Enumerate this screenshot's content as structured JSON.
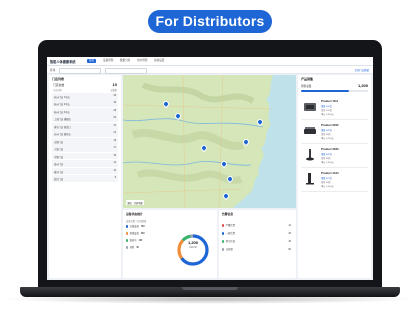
{
  "banner": {
    "label": "For Distributors"
  },
  "app": {
    "brand": "智能人体健康系统",
    "nav": [
      "总览",
      "设备管理",
      "数据分析",
      "用户管理",
      "系统设置"
    ],
    "filter_label": "区域",
    "filter_link": "全部门店数据",
    "left_panel": {
      "title": "门店列表",
      "total_label": "门店总数",
      "total_value": "10",
      "col_name": "门店名称",
      "col_count": "设备数",
      "rows": [
        {
          "name": "杭州门店 1号店",
          "count": "45"
        },
        {
          "name": "杭州门店 2号店",
          "count": "36"
        },
        {
          "name": "杭州门店 3号店",
          "count": "28"
        },
        {
          "name": "上海门店 旗舰店",
          "count": "52"
        },
        {
          "name": "南京门店 新街口",
          "count": "31"
        },
        {
          "name": "苏州门店 园区店",
          "count": "24"
        },
        {
          "name": "无锡门店",
          "count": "19"
        },
        {
          "name": "宁波门店",
          "count": "17"
        },
        {
          "name": "合肥门店",
          "count": "15"
        },
        {
          "name": "温州门店",
          "count": "12"
        },
        {
          "name": "嘉兴门店",
          "count": "10"
        },
        {
          "name": "绍兴门店",
          "count": "8"
        }
      ]
    },
    "map": {
      "tools": "图层 · 全屏地图"
    },
    "bottom_left": {
      "title": "设备状态统计",
      "subtitle": "设备总数 / 在线数量",
      "legend": [
        {
          "label": "在线设备",
          "value": "780",
          "color": "#1e66d6"
        },
        {
          "label": "离线设备",
          "value": "260",
          "color": "#f08c3a"
        },
        {
          "label": "维修中",
          "value": "120",
          "color": "#39b36b"
        },
        {
          "label": "其他",
          "value": "40",
          "color": "#9aa3ae"
        }
      ],
      "donut_value": "1,200",
      "donut_sub": "设备总数",
      "donut_fractions": [
        0.65,
        0.22,
        0.1,
        0.03
      ]
    },
    "bottom_right": {
      "title": "告警信息",
      "items": [
        {
          "label": "严重告警",
          "value": "12",
          "color": "#e5484d"
        },
        {
          "label": "一般告警",
          "value": "28",
          "color": "#1e66d6"
        },
        {
          "label": "提示信息",
          "value": "45",
          "color": "#39b36b"
        },
        {
          "label": "已处理",
          "value": "86",
          "color": "#9aa3ae"
        }
      ]
    },
    "right_panel": {
      "title": "产品销售",
      "total_label": "销售总量",
      "total_value": "1,200",
      "progress": 0.72,
      "products": [
        {
          "name": "Product 1111",
          "l1": "销量 320台",
          "l2": "库存 120台",
          "l3": "单价 2,800元"
        },
        {
          "name": "Product 2222",
          "l1": "销量 280台",
          "l2": "库存 96台",
          "l3": "单价 3,200元"
        },
        {
          "name": "Product 3333",
          "l1": "销量 260台",
          "l2": "库存 88台",
          "l3": "单价 1,900元"
        },
        {
          "name": "Product 4444",
          "l1": "销量 210台",
          "l2": "库存 64台",
          "l3": "单价 2,400元"
        }
      ]
    }
  }
}
